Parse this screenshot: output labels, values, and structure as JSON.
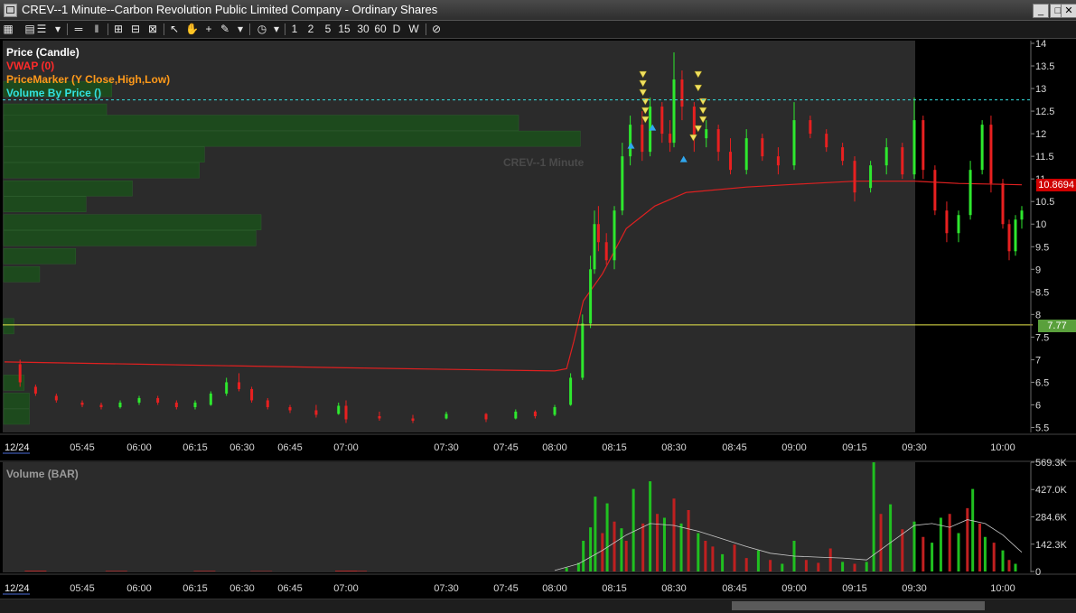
{
  "window": {
    "title": "CREV--1 Minute--Carbon Revolution Public Limited Company - Ordinary Shares",
    "buttons": [
      "_",
      "□",
      "✕"
    ]
  },
  "toolbar": {
    "timeframes": [
      "1",
      "2",
      "5",
      "15",
      "30",
      "60",
      "D",
      "W"
    ]
  },
  "legend": {
    "items": [
      {
        "label": "Price (Candle)",
        "color": "#ffffff"
      },
      {
        "label": "VWAP (0)",
        "color": "#ff2a2a"
      },
      {
        "label": "PriceMarker (Y Close,High,Low)",
        "color": "#ff9a1a"
      },
      {
        "label": "Volume By Price ()",
        "color": "#33e0e0"
      }
    ]
  },
  "watermark": "CREV--1 Minute",
  "price_tag": "10.8694",
  "level_tag": "7.77",
  "price_axis": {
    "labels": [
      "14",
      "13.5",
      "13",
      "12.5",
      "12",
      "11.5",
      "11",
      "10.5",
      "10",
      "9.5",
      "9",
      "8.5",
      "8",
      "7.5",
      "7",
      "6.5",
      "6",
      "5.5"
    ]
  },
  "time_axis": {
    "date": "12/24",
    "labels": [
      "05:45",
      "06:00",
      "06:15",
      "06:30",
      "06:45",
      "07:00",
      "07:30",
      "07:45",
      "08:00",
      "08:15",
      "08:30",
      "08:45",
      "09:00",
      "09:15",
      "09:30",
      "10:00"
    ]
  },
  "volume_pane": {
    "title": "Volume (BAR)",
    "axis_labels": [
      "569.3K",
      "427.0K",
      "284.6K",
      "142.3K",
      "0"
    ]
  },
  "chart_data": {
    "type": "candlestick",
    "title": "CREV--1 Minute",
    "ylim": [
      5.3,
      14.1
    ],
    "yticks": [
      14,
      13.5,
      13,
      12.5,
      12,
      11.5,
      11,
      10.5,
      10,
      9.5,
      9,
      8.5,
      8,
      7.5,
      7,
      6.5,
      6,
      5.5
    ],
    "candles": [
      {
        "t": "05:33",
        "o": 6.9,
        "h": 7.0,
        "l": 6.4,
        "c": 6.5
      },
      {
        "t": "05:36",
        "o": 6.4,
        "h": 6.45,
        "l": 6.2,
        "c": 6.25
      },
      {
        "t": "05:40",
        "o": 6.2,
        "h": 6.25,
        "l": 6.05,
        "c": 6.1
      },
      {
        "t": "05:45",
        "o": 6.05,
        "h": 6.1,
        "l": 5.95,
        "c": 6.0
      },
      {
        "t": "05:50",
        "o": 6.0,
        "h": 6.05,
        "l": 5.9,
        "c": 5.95
      },
      {
        "t": "05:55",
        "o": 5.95,
        "h": 6.1,
        "l": 5.92,
        "c": 6.05
      },
      {
        "t": "06:00",
        "o": 6.05,
        "h": 6.2,
        "l": 6.0,
        "c": 6.15
      },
      {
        "t": "06:05",
        "o": 6.15,
        "h": 6.2,
        "l": 6.0,
        "c": 6.05
      },
      {
        "t": "06:10",
        "o": 6.05,
        "h": 6.1,
        "l": 5.9,
        "c": 5.95
      },
      {
        "t": "06:15",
        "o": 5.95,
        "h": 6.1,
        "l": 5.9,
        "c": 6.05
      },
      {
        "t": "06:20",
        "o": 6.0,
        "h": 6.3,
        "l": 5.98,
        "c": 6.25
      },
      {
        "t": "06:25",
        "o": 6.25,
        "h": 6.6,
        "l": 6.2,
        "c": 6.5
      },
      {
        "t": "06:29",
        "o": 6.5,
        "h": 6.7,
        "l": 6.3,
        "c": 6.35
      },
      {
        "t": "06:33",
        "o": 6.35,
        "h": 6.4,
        "l": 6.05,
        "c": 6.1
      },
      {
        "t": "06:38",
        "o": 6.1,
        "h": 6.15,
        "l": 5.9,
        "c": 5.95
      },
      {
        "t": "06:45",
        "o": 5.95,
        "h": 6.0,
        "l": 5.82,
        "c": 5.88
      },
      {
        "t": "06:52",
        "o": 5.88,
        "h": 6.0,
        "l": 5.72,
        "c": 5.78
      },
      {
        "t": "06:58",
        "o": 5.8,
        "h": 6.05,
        "l": 5.78,
        "c": 5.98
      },
      {
        "t": "07:00",
        "o": 5.98,
        "h": 6.1,
        "l": 5.6,
        "c": 5.68
      },
      {
        "t": "07:10",
        "o": 5.75,
        "h": 5.85,
        "l": 5.65,
        "c": 5.7
      },
      {
        "t": "07:20",
        "o": 5.7,
        "h": 5.78,
        "l": 5.6,
        "c": 5.65
      },
      {
        "t": "07:30",
        "o": 5.7,
        "h": 5.85,
        "l": 5.68,
        "c": 5.8
      },
      {
        "t": "07:40",
        "o": 5.8,
        "h": 5.82,
        "l": 5.62,
        "c": 5.68
      },
      {
        "t": "07:48",
        "o": 5.7,
        "h": 5.9,
        "l": 5.68,
        "c": 5.85
      },
      {
        "t": "07:54",
        "o": 5.85,
        "h": 5.88,
        "l": 5.7,
        "c": 5.75
      },
      {
        "t": "08:00",
        "o": 5.78,
        "h": 6.0,
        "l": 5.75,
        "c": 5.95
      },
      {
        "t": "08:04",
        "o": 6.0,
        "h": 6.7,
        "l": 5.98,
        "c": 6.6
      },
      {
        "t": "08:07",
        "o": 6.6,
        "h": 8.0,
        "l": 6.55,
        "c": 7.8
      },
      {
        "t": "08:09",
        "o": 7.8,
        "h": 9.3,
        "l": 7.7,
        "c": 9.0
      },
      {
        "t": "08:10",
        "o": 9.0,
        "h": 10.3,
        "l": 8.9,
        "c": 10.0
      },
      {
        "t": "08:11",
        "o": 10.0,
        "h": 10.4,
        "l": 9.4,
        "c": 9.6
      },
      {
        "t": "08:13",
        "o": 9.6,
        "h": 9.8,
        "l": 9.1,
        "c": 9.2
      },
      {
        "t": "08:15",
        "o": 9.2,
        "h": 10.4,
        "l": 9.0,
        "c": 10.3
      },
      {
        "t": "08:17",
        "o": 10.3,
        "h": 11.8,
        "l": 10.2,
        "c": 11.5
      },
      {
        "t": "08:19",
        "o": 11.5,
        "h": 12.4,
        "l": 11.3,
        "c": 12.2
      },
      {
        "t": "08:22",
        "o": 12.2,
        "h": 12.5,
        "l": 11.4,
        "c": 11.6
      },
      {
        "t": "08:24",
        "o": 11.6,
        "h": 12.8,
        "l": 11.5,
        "c": 12.6
      },
      {
        "t": "08:27",
        "o": 12.6,
        "h": 12.7,
        "l": 11.8,
        "c": 12.0
      },
      {
        "t": "08:29",
        "o": 12.0,
        "h": 12.3,
        "l": 11.6,
        "c": 11.8
      },
      {
        "t": "08:30",
        "o": 11.8,
        "h": 13.8,
        "l": 11.7,
        "c": 13.2
      },
      {
        "t": "08:32",
        "o": 13.2,
        "h": 13.4,
        "l": 12.3,
        "c": 12.6
      },
      {
        "t": "08:35",
        "o": 12.6,
        "h": 12.7,
        "l": 11.6,
        "c": 11.9
      },
      {
        "t": "08:38",
        "o": 11.9,
        "h": 12.3,
        "l": 11.7,
        "c": 12.1
      },
      {
        "t": "08:41",
        "o": 12.1,
        "h": 12.2,
        "l": 11.4,
        "c": 11.6
      },
      {
        "t": "08:44",
        "o": 11.6,
        "h": 11.9,
        "l": 11.1,
        "c": 11.2
      },
      {
        "t": "08:48",
        "o": 11.2,
        "h": 12.1,
        "l": 11.1,
        "c": 11.9
      },
      {
        "t": "08:52",
        "o": 11.9,
        "h": 12.0,
        "l": 11.4,
        "c": 11.5
      },
      {
        "t": "08:56",
        "o": 11.5,
        "h": 11.7,
        "l": 11.1,
        "c": 11.3
      },
      {
        "t": "09:00",
        "o": 11.3,
        "h": 12.7,
        "l": 11.2,
        "c": 12.3
      },
      {
        "t": "09:04",
        "o": 12.3,
        "h": 12.4,
        "l": 11.9,
        "c": 12.0
      },
      {
        "t": "09:08",
        "o": 12.0,
        "h": 12.1,
        "l": 11.6,
        "c": 11.7
      },
      {
        "t": "09:12",
        "o": 11.7,
        "h": 11.8,
        "l": 11.3,
        "c": 11.4
      },
      {
        "t": "09:15",
        "o": 11.4,
        "h": 11.5,
        "l": 10.5,
        "c": 10.7
      },
      {
        "t": "09:19",
        "o": 10.8,
        "h": 11.4,
        "l": 10.7,
        "c": 11.3
      },
      {
        "t": "09:23",
        "o": 11.3,
        "h": 11.9,
        "l": 11.1,
        "c": 11.7
      },
      {
        "t": "09:27",
        "o": 11.7,
        "h": 11.8,
        "l": 11.0,
        "c": 11.1
      },
      {
        "t": "09:30",
        "o": 11.1,
        "h": 12.8,
        "l": 11.0,
        "c": 12.3
      },
      {
        "t": "09:33",
        "o": 12.3,
        "h": 12.4,
        "l": 11.0,
        "c": 11.2
      },
      {
        "t": "09:37",
        "o": 11.2,
        "h": 11.3,
        "l": 10.2,
        "c": 10.3
      },
      {
        "t": "09:41",
        "o": 10.3,
        "h": 10.5,
        "l": 9.6,
        "c": 9.8
      },
      {
        "t": "09:45",
        "o": 9.8,
        "h": 10.3,
        "l": 9.6,
        "c": 10.2
      },
      {
        "t": "09:49",
        "o": 10.2,
        "h": 11.4,
        "l": 10.1,
        "c": 11.2
      },
      {
        "t": "09:53",
        "o": 11.2,
        "h": 12.3,
        "l": 11.1,
        "c": 12.2
      },
      {
        "t": "09:56",
        "o": 12.2,
        "h": 12.4,
        "l": 10.7,
        "c": 10.9
      },
      {
        "t": "10:00",
        "o": 10.9,
        "h": 11.0,
        "l": 9.9,
        "c": 10.0
      },
      {
        "t": "10:03",
        "o": 10.0,
        "h": 10.1,
        "l": 9.2,
        "c": 9.4
      },
      {
        "t": "10:06",
        "o": 9.4,
        "h": 10.2,
        "l": 9.3,
        "c": 10.1
      },
      {
        "t": "10:09",
        "o": 10.1,
        "h": 10.4,
        "l": 9.9,
        "c": 10.3
      }
    ],
    "vwap": [
      [
        5.33,
        6.95
      ],
      [
        6.0,
        6.9
      ],
      [
        7.0,
        6.82
      ],
      [
        8.0,
        6.75
      ],
      [
        8.05,
        6.8
      ],
      [
        8.08,
        7.4
      ],
      [
        8.12,
        8.3
      ],
      [
        8.2,
        8.9
      ],
      [
        8.3,
        9.9
      ],
      [
        8.42,
        10.4
      ],
      [
        8.55,
        10.7
      ],
      [
        8.8,
        10.82
      ],
      [
        9.0,
        10.88
      ],
      [
        9.25,
        10.95
      ],
      [
        9.5,
        10.95
      ],
      [
        9.75,
        10.9
      ],
      [
        10.0,
        10.88
      ],
      [
        10.15,
        10.87
      ]
    ],
    "last_price": 10.8694,
    "horizontal_levels": [
      {
        "price": 12.75,
        "style": "dashed",
        "color": "#33e0e0"
      },
      {
        "price": 7.77,
        "style": "solid",
        "color": "#e8e84a"
      }
    ],
    "volume_by_price": [
      {
        "price": 13.0,
        "volume": 0.21
      },
      {
        "price": 12.5,
        "volume": 0.2
      },
      {
        "price": 12.25,
        "volume": 1.0
      },
      {
        "price": 11.9,
        "volume": 1.12
      },
      {
        "price": 11.55,
        "volume": 0.39
      },
      {
        "price": 11.2,
        "volume": 0.38
      },
      {
        "price": 10.8,
        "volume": 0.25
      },
      {
        "price": 10.45,
        "volume": 0.16
      },
      {
        "price": 10.05,
        "volume": 0.5
      },
      {
        "price": 9.7,
        "volume": 0.49
      },
      {
        "price": 9.3,
        "volume": 0.14
      },
      {
        "price": 8.9,
        "volume": 0.07
      },
      {
        "price": 7.75,
        "volume": 0.02
      },
      {
        "price": 6.5,
        "volume": 0.04
      },
      {
        "price": 6.1,
        "volume": 0.05
      },
      {
        "price": 5.75,
        "volume": 0.05
      }
    ],
    "price_markers_down": [
      [
        8.37,
        13.3
      ],
      [
        8.37,
        13.1
      ],
      [
        8.37,
        12.9
      ],
      [
        8.38,
        12.7
      ],
      [
        8.38,
        12.5
      ],
      [
        8.38,
        12.3
      ],
      [
        8.6,
        13.3
      ],
      [
        8.6,
        13.0
      ],
      [
        8.62,
        12.7
      ],
      [
        8.62,
        12.5
      ],
      [
        8.62,
        12.3
      ],
      [
        8.6,
        12.1
      ],
      [
        8.58,
        11.9
      ]
    ],
    "price_markers_up": [
      [
        8.32,
        11.75
      ],
      [
        8.41,
        12.15
      ],
      [
        8.54,
        11.45
      ]
    ],
    "volume": {
      "ylim": [
        0,
        569.3
      ],
      "unit": "K",
      "yticks": [
        "569.3K",
        "427.0K",
        "284.6K",
        "142.3K",
        "0"
      ],
      "bars": [
        {
          "t": 8.05,
          "v": 20,
          "c": "#20c020"
        },
        {
          "t": 8.1,
          "v": 45,
          "c": "#20c020"
        },
        {
          "t": 8.12,
          "v": 160,
          "c": "#20c020"
        },
        {
          "t": 8.15,
          "v": 230,
          "c": "#20c020"
        },
        {
          "t": 8.17,
          "v": 390,
          "c": "#20c020"
        },
        {
          "t": 8.2,
          "v": 200,
          "c": "#c02020"
        },
        {
          "t": 8.22,
          "v": 355,
          "c": "#20c020"
        },
        {
          "t": 8.25,
          "v": 260,
          "c": "#c02020"
        },
        {
          "t": 8.28,
          "v": 225,
          "c": "#20c020"
        },
        {
          "t": 8.3,
          "v": 160,
          "c": "#c02020"
        },
        {
          "t": 8.33,
          "v": 430,
          "c": "#20c020"
        },
        {
          "t": 8.37,
          "v": 250,
          "c": "#c02020"
        },
        {
          "t": 8.4,
          "v": 470,
          "c": "#20c020"
        },
        {
          "t": 8.43,
          "v": 300,
          "c": "#c02020"
        },
        {
          "t": 8.46,
          "v": 280,
          "c": "#20c020"
        },
        {
          "t": 8.5,
          "v": 380,
          "c": "#c02020"
        },
        {
          "t": 8.53,
          "v": 250,
          "c": "#20c020"
        },
        {
          "t": 8.56,
          "v": 320,
          "c": "#c02020"
        },
        {
          "t": 8.6,
          "v": 200,
          "c": "#20c020"
        },
        {
          "t": 8.63,
          "v": 160,
          "c": "#c02020"
        },
        {
          "t": 8.66,
          "v": 130,
          "c": "#c02020"
        },
        {
          "t": 8.7,
          "v": 90,
          "c": "#20c020"
        },
        {
          "t": 8.75,
          "v": 140,
          "c": "#c02020"
        },
        {
          "t": 8.8,
          "v": 70,
          "c": "#c02020"
        },
        {
          "t": 8.85,
          "v": 110,
          "c": "#20c020"
        },
        {
          "t": 8.9,
          "v": 60,
          "c": "#c02020"
        },
        {
          "t": 8.95,
          "v": 40,
          "c": "#20c020"
        },
        {
          "t": 9.0,
          "v": 160,
          "c": "#20c020"
        },
        {
          "t": 9.05,
          "v": 60,
          "c": "#c02020"
        },
        {
          "t": 9.1,
          "v": 45,
          "c": "#c02020"
        },
        {
          "t": 9.15,
          "v": 120,
          "c": "#c02020"
        },
        {
          "t": 9.2,
          "v": 50,
          "c": "#20c020"
        },
        {
          "t": 9.25,
          "v": 40,
          "c": "#c02020"
        },
        {
          "t": 9.3,
          "v": 50,
          "c": "#20c020"
        },
        {
          "t": 9.33,
          "v": 569,
          "c": "#20c020"
        },
        {
          "t": 9.36,
          "v": 300,
          "c": "#c02020"
        },
        {
          "t": 9.4,
          "v": 350,
          "c": "#20c020"
        },
        {
          "t": 9.45,
          "v": 220,
          "c": "#c02020"
        },
        {
          "t": 9.5,
          "v": 260,
          "c": "#20c020"
        },
        {
          "t": 9.55,
          "v": 180,
          "c": "#c02020"
        },
        {
          "t": 9.6,
          "v": 150,
          "c": "#20c020"
        },
        {
          "t": 9.65,
          "v": 280,
          "c": "#20c020"
        },
        {
          "t": 9.7,
          "v": 300,
          "c": "#c02020"
        },
        {
          "t": 9.75,
          "v": 200,
          "c": "#20c020"
        },
        {
          "t": 9.8,
          "v": 330,
          "c": "#c02020"
        },
        {
          "t": 9.83,
          "v": 430,
          "c": "#20c020"
        },
        {
          "t": 9.87,
          "v": 250,
          "c": "#c02020"
        },
        {
          "t": 9.9,
          "v": 180,
          "c": "#20c020"
        },
        {
          "t": 9.95,
          "v": 150,
          "c": "#c02020"
        },
        {
          "t": 10.0,
          "v": 110,
          "c": "#20c020"
        },
        {
          "t": 10.05,
          "v": 60,
          "c": "#c02020"
        },
        {
          "t": 10.1,
          "v": 40,
          "c": "#20c020"
        }
      ],
      "average": [
        [
          8.0,
          5
        ],
        [
          8.1,
          40
        ],
        [
          8.2,
          110
        ],
        [
          8.3,
          190
        ],
        [
          8.4,
          250
        ],
        [
          8.5,
          240
        ],
        [
          8.6,
          210
        ],
        [
          8.7,
          170
        ],
        [
          8.8,
          130
        ],
        [
          8.9,
          95
        ],
        [
          9.0,
          80
        ],
        [
          9.1,
          75
        ],
        [
          9.2,
          70
        ],
        [
          9.3,
          60
        ],
        [
          9.4,
          150
        ],
        [
          9.5,
          240
        ],
        [
          9.6,
          250
        ],
        [
          9.7,
          230
        ],
        [
          9.8,
          270
        ],
        [
          9.9,
          250
        ],
        [
          10.0,
          190
        ],
        [
          10.1,
          130
        ],
        [
          10.15,
          100
        ]
      ]
    }
  }
}
